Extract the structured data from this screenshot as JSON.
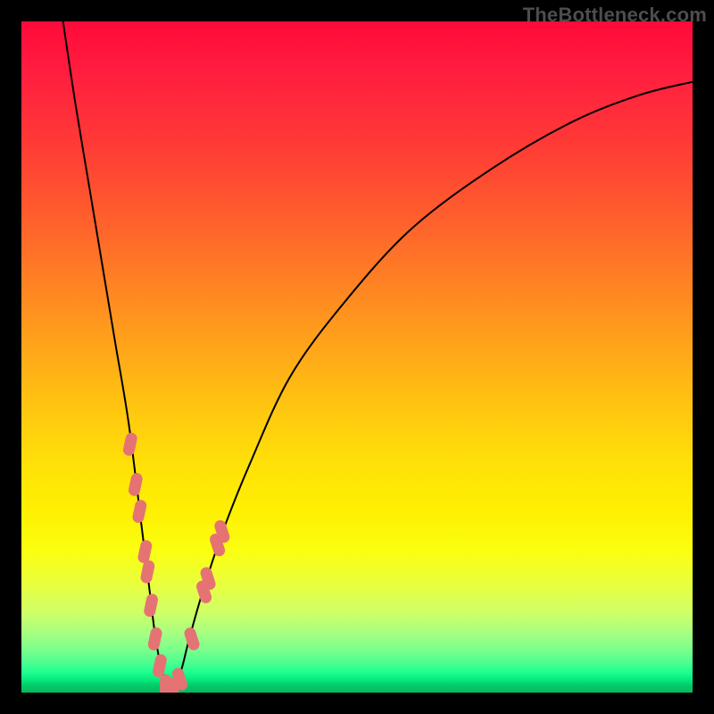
{
  "watermark": "TheBottleneck.com",
  "chart_data": {
    "type": "line",
    "title": "",
    "xlabel": "",
    "ylabel": "",
    "xlim": [
      0,
      100
    ],
    "ylim": [
      0,
      100
    ],
    "note": "Axis ticks/labels are not rendered in the image; x and y are expressed as percentages of the plot area. y≈0 corresponds to the green (good) zone. Curve minimum (≈0% bottleneck) occurs near x≈22.",
    "series": [
      {
        "name": "bottleneck-curve",
        "x": [
          6,
          8,
          10,
          12,
          14,
          16,
          18,
          19,
          20,
          21,
          22,
          23,
          24,
          25,
          27,
          30,
          34,
          40,
          48,
          58,
          70,
          82,
          92,
          100
        ],
        "y": [
          100,
          88,
          76,
          64,
          52,
          40,
          24,
          16,
          8,
          3,
          0,
          1,
          4,
          8,
          15,
          24,
          34,
          47,
          58,
          69,
          78,
          85,
          89,
          91
        ],
        "stroke": "#000000",
        "stroke_width": 2
      }
    ],
    "markers": {
      "name": "highlighted-points",
      "note": "Pink rounded markers clustered near the curve minimum on both branches.",
      "color": "#e57373",
      "points": [
        {
          "x": 16.2,
          "y": 37
        },
        {
          "x": 17.0,
          "y": 31
        },
        {
          "x": 17.6,
          "y": 27
        },
        {
          "x": 18.4,
          "y": 21
        },
        {
          "x": 18.8,
          "y": 18
        },
        {
          "x": 19.3,
          "y": 13
        },
        {
          "x": 19.9,
          "y": 8
        },
        {
          "x": 20.6,
          "y": 4
        },
        {
          "x": 21.5,
          "y": 1
        },
        {
          "x": 22.6,
          "y": 0.5
        },
        {
          "x": 23.6,
          "y": 2
        },
        {
          "x": 25.4,
          "y": 8
        },
        {
          "x": 27.2,
          "y": 15
        },
        {
          "x": 27.8,
          "y": 17
        },
        {
          "x": 29.2,
          "y": 22
        },
        {
          "x": 29.9,
          "y": 24
        }
      ]
    }
  }
}
